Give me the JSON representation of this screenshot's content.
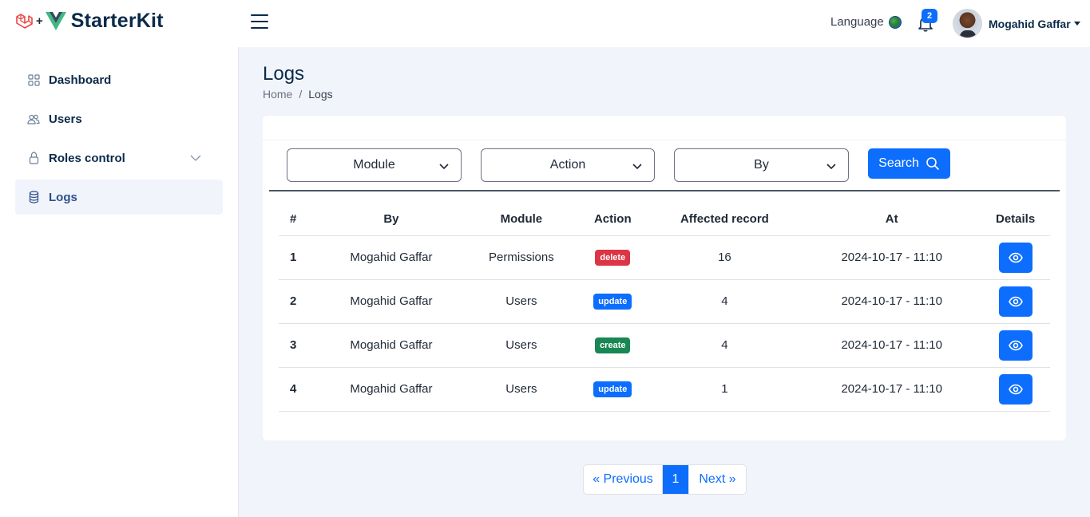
{
  "brand": {
    "name": "StarterKit",
    "plus": "+"
  },
  "header": {
    "language_label": "Language",
    "notification_count": "2",
    "user_name": "Mogahid Gaffar"
  },
  "sidebar": {
    "items": [
      {
        "label": "Dashboard",
        "icon": "grid-icon"
      },
      {
        "label": "Users",
        "icon": "users-icon"
      },
      {
        "label": "Roles control",
        "icon": "lock-icon"
      },
      {
        "label": "Logs",
        "icon": "database-icon"
      }
    ]
  },
  "page": {
    "title": "Logs",
    "breadcrumb": {
      "home": "Home",
      "sep": "/",
      "current": "Logs"
    }
  },
  "filters": {
    "module": "Module",
    "action": "Action",
    "by": "By",
    "search_label": "Search"
  },
  "table": {
    "headers": [
      "#",
      "By",
      "Module",
      "Action",
      "Affected record",
      "At",
      "Details"
    ],
    "rows": [
      {
        "n": "1",
        "by": "Mogahid Gaffar",
        "module": "Permissions",
        "action": "delete",
        "affected": "16",
        "at": "2024-10-17 - 11:10"
      },
      {
        "n": "2",
        "by": "Mogahid Gaffar",
        "module": "Users",
        "action": "update",
        "affected": "4",
        "at": "2024-10-17 - 11:10"
      },
      {
        "n": "3",
        "by": "Mogahid Gaffar",
        "module": "Users",
        "action": "create",
        "affected": "4",
        "at": "2024-10-17 - 11:10"
      },
      {
        "n": "4",
        "by": "Mogahid Gaffar",
        "module": "Users",
        "action": "update",
        "affected": "1",
        "at": "2024-10-17 - 11:10"
      }
    ]
  },
  "badge_colors": {
    "delete": "#dc3545",
    "update": "#0d6efd",
    "create": "#198754"
  },
  "pagination": {
    "prev": "« Previous",
    "current": "1",
    "next": "Next »"
  }
}
